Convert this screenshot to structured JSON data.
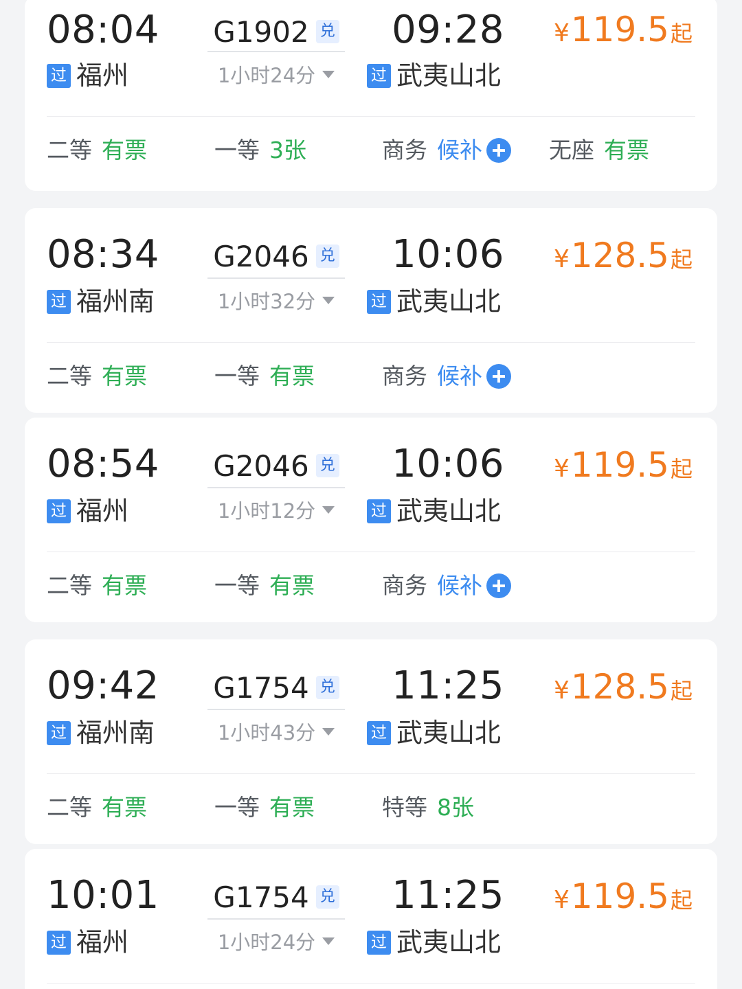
{
  "colors": {
    "price": "#f07a1f",
    "available": "#2eae55",
    "waitlist": "#3d8cf0",
    "badge": "#3d8cf0"
  },
  "icons": {
    "pass_badge": "过",
    "exchange_badge": "兑",
    "waitlist_icon": "plus-circle-icon",
    "dropdown_icon": "caret-down-icon"
  },
  "trains": [
    {
      "dep_time": "08:04",
      "dep_station": "福州",
      "train_no": "G1902",
      "duration": "1小时24分",
      "arr_time": "09:28",
      "arr_station": "武夷山北",
      "price_symbol": "¥",
      "price": "119.5",
      "price_suffix": "起",
      "seats": [
        {
          "name": "二等",
          "status": "有票",
          "kind": "available"
        },
        {
          "name": "一等",
          "status": "3张",
          "kind": "available"
        },
        {
          "name": "商务",
          "status": "候补",
          "kind": "waitlist"
        },
        {
          "name": "无座",
          "status": "有票",
          "kind": "available"
        }
      ]
    },
    {
      "dep_time": "08:34",
      "dep_station": "福州南",
      "train_no": "G2046",
      "duration": "1小时32分",
      "arr_time": "10:06",
      "arr_station": "武夷山北",
      "price_symbol": "¥",
      "price": "128.5",
      "price_suffix": "起",
      "seats": [
        {
          "name": "二等",
          "status": "有票",
          "kind": "available"
        },
        {
          "name": "一等",
          "status": "有票",
          "kind": "available"
        },
        {
          "name": "商务",
          "status": "候补",
          "kind": "waitlist"
        }
      ]
    },
    {
      "dep_time": "08:54",
      "dep_station": "福州",
      "train_no": "G2046",
      "duration": "1小时12分",
      "arr_time": "10:06",
      "arr_station": "武夷山北",
      "price_symbol": "¥",
      "price": "119.5",
      "price_suffix": "起",
      "seats": [
        {
          "name": "二等",
          "status": "有票",
          "kind": "available"
        },
        {
          "name": "一等",
          "status": "有票",
          "kind": "available"
        },
        {
          "name": "商务",
          "status": "候补",
          "kind": "waitlist"
        }
      ]
    },
    {
      "dep_time": "09:42",
      "dep_station": "福州南",
      "train_no": "G1754",
      "duration": "1小时43分",
      "arr_time": "11:25",
      "arr_station": "武夷山北",
      "price_symbol": "¥",
      "price": "128.5",
      "price_suffix": "起",
      "seats": [
        {
          "name": "二等",
          "status": "有票",
          "kind": "available"
        },
        {
          "name": "一等",
          "status": "有票",
          "kind": "available"
        },
        {
          "name": "特等",
          "status": "8张",
          "kind": "available"
        }
      ]
    },
    {
      "dep_time": "10:01",
      "dep_station": "福州",
      "train_no": "G1754",
      "duration": "1小时24分",
      "arr_time": "11:25",
      "arr_station": "武夷山北",
      "price_symbol": "¥",
      "price": "119.5",
      "price_suffix": "起",
      "seats": []
    }
  ]
}
